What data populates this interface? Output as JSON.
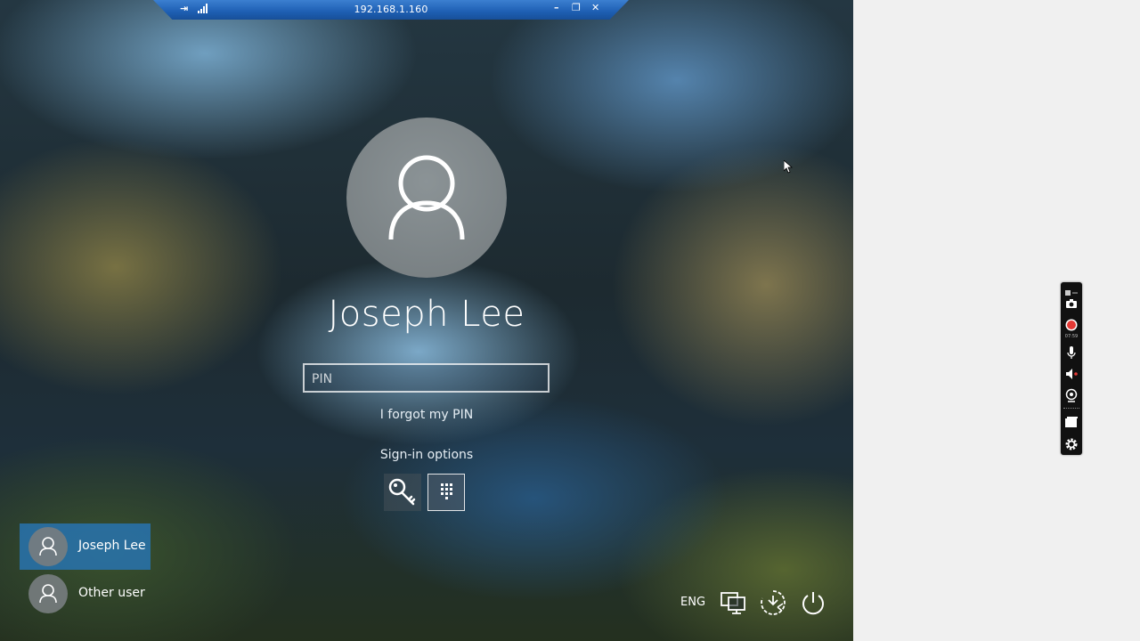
{
  "rdp_bar": {
    "host": "192.168.1.160"
  },
  "login": {
    "user_name": "Joseph Lee",
    "pin_placeholder": "PIN",
    "pin_value": "",
    "forgot_pin_link": "I forgot my PIN",
    "sign_in_options_label": "Sign-in options",
    "sign_in_options": [
      {
        "icon": "key-icon",
        "selected": false
      },
      {
        "icon": "pin-keypad-icon",
        "selected": true
      }
    ]
  },
  "user_list": [
    {
      "name": "Joseph Lee",
      "selected": true
    },
    {
      "name": "Other user",
      "selected": false
    }
  ],
  "system_tray": {
    "language": "ENG",
    "icons": [
      "network-icon",
      "ease-of-access-icon",
      "power-icon"
    ]
  },
  "recorder_toolbar": {
    "timer": "07:59",
    "icons": [
      "screenshot-camera-icon",
      "record-icon",
      "microphone-icon",
      "speaker-icon",
      "webcam-icon",
      "window-icon",
      "settings-gear-icon"
    ],
    "record_color": "#e53935"
  },
  "colors": {
    "selected_user_tile": "#2873af",
    "rdp_bar": "#1e5fb3"
  }
}
